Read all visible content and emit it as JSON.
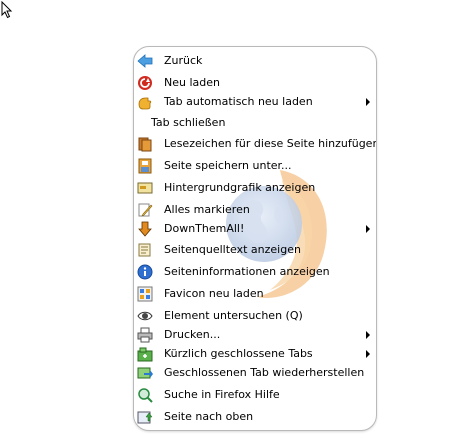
{
  "menu": {
    "items": [
      {
        "label": "Zurück",
        "icon": "back-arrow-icon",
        "submenu": false
      },
      {
        "label": "Neu laden",
        "icon": "reload-icon",
        "submenu": false
      },
      {
        "label": "Tab automatisch neu laden",
        "icon": "auto-reload-hand-icon",
        "submenu": true
      },
      {
        "label": "Tab schließen",
        "icon": "",
        "submenu": false
      },
      {
        "label": "Lesezeichen für diese Seite hinzufügen",
        "icon": "bookmark-icon",
        "submenu": false
      },
      {
        "label": "Seite speichern unter...",
        "icon": "save-page-icon",
        "submenu": false
      },
      {
        "label": "Hintergrundgrafik anzeigen",
        "icon": "background-image-icon",
        "submenu": false
      },
      {
        "label": "Alles markieren",
        "icon": "select-all-pencil-icon",
        "submenu": false
      },
      {
        "label": "DownThemAll!",
        "icon": "downthemall-icon",
        "submenu": true
      },
      {
        "label": "Seitenquelltext anzeigen",
        "icon": "view-source-icon",
        "submenu": false
      },
      {
        "label": "Seiteninformationen anzeigen",
        "icon": "page-info-icon",
        "submenu": false
      },
      {
        "label": "Favicon neu laden",
        "icon": "favicon-reload-icon",
        "submenu": false
      },
      {
        "label": "Element untersuchen (Q)",
        "icon": "inspect-eye-icon",
        "submenu": false
      },
      {
        "label": "Drucken...",
        "icon": "printer-icon",
        "submenu": true
      },
      {
        "label": "Kürzlich geschlossene Tabs",
        "icon": "recent-tabs-icon",
        "submenu": true
      },
      {
        "label": "Geschlossenen Tab wiederherstellen",
        "icon": "restore-tab-icon",
        "submenu": false
      },
      {
        "label": "Suche in Firefox Hilfe",
        "icon": "help-search-icon",
        "submenu": false
      },
      {
        "label": "Seite nach oben",
        "icon": "page-up-icon",
        "submenu": false
      }
    ]
  }
}
